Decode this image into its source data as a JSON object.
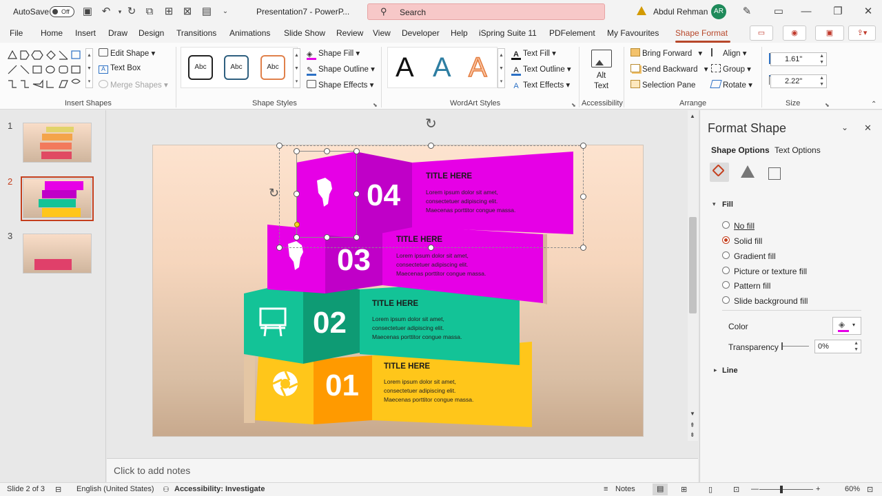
{
  "titlebar": {
    "autosave_label": "AutoSave",
    "autosave_state": "Off",
    "doc_title": "Presentation7 - PowerP...",
    "search_placeholder": "Search",
    "user_name": "Abdul Rehman",
    "user_initials": "AR"
  },
  "menu": {
    "tabs": [
      "File",
      "Home",
      "Insert",
      "Draw",
      "Design",
      "Transitions",
      "Animations",
      "Slide Show",
      "Review",
      "View",
      "Developer",
      "Help",
      "iSpring Suite 11",
      "PDFelement",
      "My Favourites",
      "Shape Format"
    ],
    "active_tab": "Shape Format"
  },
  "ribbon": {
    "insert_shapes": {
      "label": "Insert Shapes",
      "edit_shape": "Edit Shape",
      "text_box": "Text Box",
      "merge_shapes": "Merge Shapes"
    },
    "shape_styles": {
      "label": "Shape Styles",
      "style_samples": [
        "Abc",
        "Abc",
        "Abc"
      ],
      "shape_fill": "Shape Fill",
      "shape_outline": "Shape Outline",
      "shape_effects": "Shape Effects"
    },
    "wordart": {
      "label": "WordArt Styles",
      "letters": [
        "A",
        "A",
        "A"
      ],
      "text_fill": "Text Fill",
      "text_outline": "Text Outline",
      "text_effects": "Text Effects"
    },
    "accessibility": {
      "label": "Accessibility",
      "alt_text_line1": "Alt",
      "alt_text_line2": "Text"
    },
    "arrange": {
      "label": "Arrange",
      "bring_forward": "Bring Forward",
      "send_backward": "Send Backward",
      "selection_pane": "Selection Pane",
      "align": "Align",
      "group": "Group",
      "rotate": "Rotate"
    },
    "size": {
      "label": "Size",
      "height": "1.61\"",
      "width": "2.22\""
    }
  },
  "thumbnails": {
    "numbers": [
      "1",
      "2",
      "3"
    ],
    "active": "2"
  },
  "slide": {
    "bands": [
      {
        "number": "04",
        "title": "TITLE HERE",
        "body": [
          "Lorem ipsum dolor sit amet,",
          "consectetuer adipiscing elit.",
          "Maecenas porttitor congue massa."
        ],
        "icon": "africa-map-icon"
      },
      {
        "number": "03",
        "title": "TITLE HERE",
        "body": [
          "Lorem ipsum dolor sit amet,",
          "consectetuer adipiscing elit.",
          "Maecenas porttitor congue massa."
        ],
        "icon": "africa-map-icon"
      },
      {
        "number": "02",
        "title": "TITLE HERE",
        "body": [
          "Lorem ipsum dolor sit amet,",
          "consectetuer adipiscing elit.",
          "Maecenas porttitor congue massa."
        ],
        "icon": "billboard-icon"
      },
      {
        "number": "01",
        "title": "TITLE HERE",
        "body": [
          "Lorem ipsum dolor sit amet,",
          "consectetuer adipiscing elit.",
          "Maecenas porttitor congue massa."
        ],
        "icon": "aperture-icon"
      }
    ],
    "colors": {
      "magenta": "#e600e6",
      "magenta_dark": "#c000c8",
      "teal": "#13c397",
      "teal_dark": "#0e9b74",
      "yellow": "#ffc61a",
      "orange": "#ff9a00"
    }
  },
  "notes_placeholder": "Click to add notes",
  "format_pane": {
    "title": "Format Shape",
    "tabs": [
      "Shape Options",
      "Text Options"
    ],
    "fill_section": "Fill",
    "fill_options": [
      "No fill",
      "Solid fill",
      "Gradient fill",
      "Picture or texture fill",
      "Pattern fill",
      "Slide background fill"
    ],
    "selected_fill": "Solid fill",
    "color_label": "Color",
    "fill_color": "#e600e6",
    "transparency_label": "Transparency",
    "transparency_value": "0%",
    "line_section": "Line"
  },
  "statusbar": {
    "slide_info": "Slide 2 of 3",
    "language": "English (United States)",
    "accessibility": "Accessibility: Investigate",
    "notes": "Notes",
    "zoom": "60%"
  }
}
